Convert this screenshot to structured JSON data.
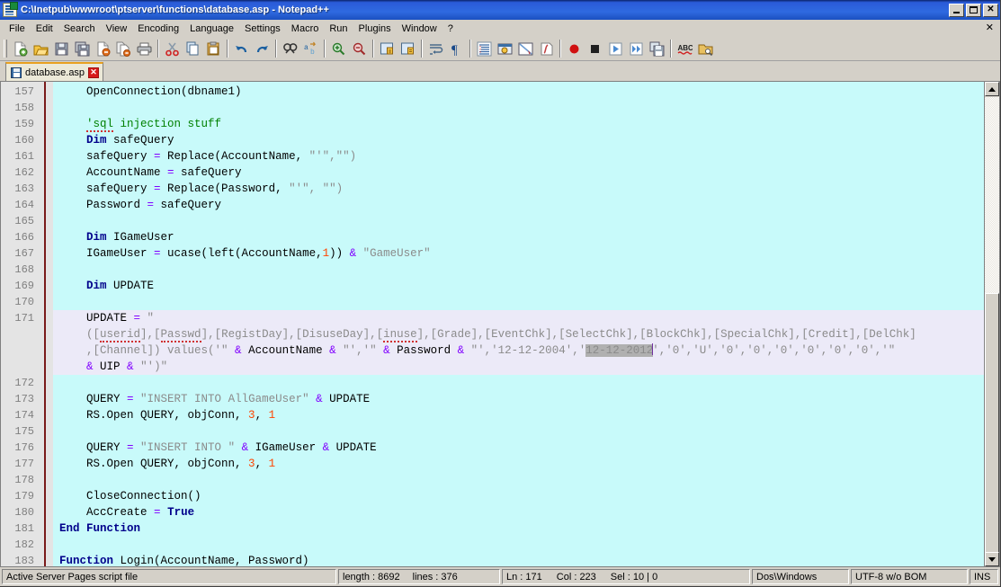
{
  "window": {
    "title": "C:\\Inetpub\\wwwroot\\ptserver\\functions\\database.asp - Notepad++",
    "icon": "notepad-plus-plus-icon",
    "minimize_label": "",
    "maximize_label": "",
    "close_label": "✕",
    "doc_close_label": "✕"
  },
  "menu": {
    "items": [
      {
        "label": "File"
      },
      {
        "label": "Edit"
      },
      {
        "label": "Search"
      },
      {
        "label": "View"
      },
      {
        "label": "Encoding"
      },
      {
        "label": "Language"
      },
      {
        "label": "Settings"
      },
      {
        "label": "Macro"
      },
      {
        "label": "Run"
      },
      {
        "label": "Plugins"
      },
      {
        "label": "Window"
      },
      {
        "label": "?"
      }
    ]
  },
  "toolbar": {
    "buttons": [
      {
        "name": "new-file-icon",
        "tooltip": "New"
      },
      {
        "name": "open-file-icon",
        "tooltip": "Open"
      },
      {
        "name": "save-icon",
        "tooltip": "Save"
      },
      {
        "name": "save-all-icon",
        "tooltip": "Save All"
      },
      {
        "name": "close-file-icon",
        "tooltip": "Close"
      },
      {
        "name": "close-all-icon",
        "tooltip": "Close All"
      },
      {
        "name": "print-icon",
        "tooltip": "Print"
      },
      {
        "name": "cut-icon",
        "tooltip": "Cut"
      },
      {
        "name": "copy-icon",
        "tooltip": "Copy"
      },
      {
        "name": "paste-icon",
        "tooltip": "Paste"
      },
      {
        "name": "undo-icon",
        "tooltip": "Undo"
      },
      {
        "name": "redo-icon",
        "tooltip": "Redo"
      },
      {
        "name": "find-icon",
        "tooltip": "Find"
      },
      {
        "name": "replace-icon",
        "tooltip": "Replace"
      },
      {
        "name": "zoom-in-icon",
        "tooltip": "Zoom In"
      },
      {
        "name": "zoom-out-icon",
        "tooltip": "Zoom Out"
      },
      {
        "name": "sync-vertical-icon",
        "tooltip": "Synchronize Vertical Scrolling"
      },
      {
        "name": "sync-horizontal-icon",
        "tooltip": "Synchronize Horizontal Scrolling"
      },
      {
        "name": "word-wrap-icon",
        "tooltip": "Word wrap"
      },
      {
        "name": "show-all-chars-icon",
        "tooltip": "Show All Characters"
      },
      {
        "name": "indent-guide-icon",
        "tooltip": "Show Indent Guide"
      },
      {
        "name": "user-defined-dlg-icon",
        "tooltip": "User-Defined Dialogue"
      },
      {
        "name": "doc-map-icon",
        "tooltip": "Document Map"
      },
      {
        "name": "function-list-icon",
        "tooltip": "Function List"
      },
      {
        "name": "record-macro-icon",
        "tooltip": "Start Recording"
      },
      {
        "name": "stop-macro-icon",
        "tooltip": "Stop Recording"
      },
      {
        "name": "play-macro-icon",
        "tooltip": "Playback"
      },
      {
        "name": "run-macro-multi-icon",
        "tooltip": "Run a Macro Multiple Times"
      },
      {
        "name": "save-macro-icon",
        "tooltip": "Save Current Recorded Macro"
      },
      {
        "name": "spell-check-icon",
        "tooltip": "Spell Check"
      },
      {
        "name": "run-icon",
        "tooltip": "Run"
      }
    ]
  },
  "tabs": [
    {
      "label": "database.asp",
      "icon": "saved-file-icon",
      "close_label": "✕",
      "active": true
    }
  ],
  "editor": {
    "first_line": 157,
    "lines": [
      {
        "num": "157",
        "highlight": false,
        "tokens": [
          {
            "t": "    OpenConnection(dbname1)",
            "c": "plain"
          }
        ]
      },
      {
        "num": "158",
        "highlight": false,
        "tokens": []
      },
      {
        "num": "159",
        "highlight": false,
        "tokens": [
          {
            "t": "    ",
            "c": "plain"
          },
          {
            "t": "'sql",
            "c": "cmt",
            "squiggly": true
          },
          {
            "t": " injection stuff",
            "c": "cmt"
          }
        ]
      },
      {
        "num": "160",
        "highlight": false,
        "tokens": [
          {
            "t": "    ",
            "c": "plain"
          },
          {
            "t": "Dim",
            "c": "kw"
          },
          {
            "t": " safeQuery",
            "c": "plain"
          }
        ]
      },
      {
        "num": "161",
        "highlight": false,
        "tokens": [
          {
            "t": "    safeQuery ",
            "c": "plain"
          },
          {
            "t": "=",
            "c": "op"
          },
          {
            "t": " Replace(AccountName, ",
            "c": "plain"
          },
          {
            "t": "\"'\",\"\")",
            "c": "str"
          }
        ]
      },
      {
        "num": "162",
        "highlight": false,
        "tokens": [
          {
            "t": "    AccountName ",
            "c": "plain"
          },
          {
            "t": "=",
            "c": "op"
          },
          {
            "t": " safeQuery",
            "c": "plain"
          }
        ]
      },
      {
        "num": "163",
        "highlight": false,
        "tokens": [
          {
            "t": "    safeQuery ",
            "c": "plain"
          },
          {
            "t": "=",
            "c": "op"
          },
          {
            "t": " Replace(Password, ",
            "c": "plain"
          },
          {
            "t": "\"'\", \"\")",
            "c": "str"
          }
        ]
      },
      {
        "num": "164",
        "highlight": false,
        "tokens": [
          {
            "t": "    Password ",
            "c": "plain"
          },
          {
            "t": "=",
            "c": "op"
          },
          {
            "t": " safeQuery",
            "c": "plain"
          }
        ]
      },
      {
        "num": "165",
        "highlight": false,
        "tokens": []
      },
      {
        "num": "166",
        "highlight": false,
        "tokens": [
          {
            "t": "    ",
            "c": "plain"
          },
          {
            "t": "Dim",
            "c": "kw"
          },
          {
            "t": " IGameUser",
            "c": "plain"
          }
        ]
      },
      {
        "num": "167",
        "highlight": false,
        "tokens": [
          {
            "t": "    IGameUser ",
            "c": "plain"
          },
          {
            "t": "=",
            "c": "op"
          },
          {
            "t": " ucase(left(AccountName,",
            "c": "plain"
          },
          {
            "t": "1",
            "c": "num"
          },
          {
            "t": ")) ",
            "c": "plain"
          },
          {
            "t": "&",
            "c": "op"
          },
          {
            "t": " ",
            "c": "plain"
          },
          {
            "t": "\"GameUser\"",
            "c": "str"
          }
        ]
      },
      {
        "num": "168",
        "highlight": false,
        "tokens": []
      },
      {
        "num": "169",
        "highlight": false,
        "tokens": [
          {
            "t": "    ",
            "c": "plain"
          },
          {
            "t": "Dim",
            "c": "kw"
          },
          {
            "t": " UPDATE",
            "c": "plain"
          }
        ]
      },
      {
        "num": "170",
        "highlight": false,
        "tokens": []
      },
      {
        "num": "171",
        "highlight": true,
        "tokens": [
          {
            "t": "    UPDATE ",
            "c": "plain"
          },
          {
            "t": "=",
            "c": "op"
          },
          {
            "t": " \"",
            "c": "str"
          }
        ]
      },
      {
        "num": "",
        "highlight": true,
        "tokens": [
          {
            "t": "    ([",
            "c": "str"
          },
          {
            "t": "userid",
            "c": "str",
            "squiggly": true
          },
          {
            "t": "],[",
            "c": "str"
          },
          {
            "t": "Passwd",
            "c": "str",
            "squiggly": true
          },
          {
            "t": "],[RegistDay],[DisuseDay],[",
            "c": "str"
          },
          {
            "t": "inuse",
            "c": "str",
            "squiggly": true
          },
          {
            "t": "],[Grade],[EventChk],[SelectChk],[BlockChk],[SpecialChk],[Credit],[DelChk]",
            "c": "str"
          }
        ]
      },
      {
        "num": "",
        "highlight": true,
        "tokens": [
          {
            "t": "    ,[Channel]) values('\" ",
            "c": "str"
          },
          {
            "t": "&",
            "c": "op"
          },
          {
            "t": " AccountName ",
            "c": "plain"
          },
          {
            "t": "&",
            "c": "op"
          },
          {
            "t": " \"','\" ",
            "c": "str"
          },
          {
            "t": "&",
            "c": "op"
          },
          {
            "t": " Password ",
            "c": "plain"
          },
          {
            "t": "&",
            "c": "op"
          },
          {
            "t": " \"','12-12-2004','",
            "c": "str"
          },
          {
            "t": "12-12-2012",
            "c": "str",
            "selected": true
          },
          {
            "t": "",
            "c": "caret"
          },
          {
            "t": "','0','U','0','0','0','0','0','0','\"",
            "c": "str"
          }
        ]
      },
      {
        "num": "",
        "highlight": true,
        "tokens": [
          {
            "t": "    ",
            "c": "str"
          },
          {
            "t": "&",
            "c": "op"
          },
          {
            "t": " UIP ",
            "c": "plain"
          },
          {
            "t": "&",
            "c": "op"
          },
          {
            "t": " \"')\"",
            "c": "str"
          }
        ]
      },
      {
        "num": "172",
        "highlight": false,
        "tokens": []
      },
      {
        "num": "173",
        "highlight": false,
        "tokens": [
          {
            "t": "    QUERY ",
            "c": "plain"
          },
          {
            "t": "=",
            "c": "op"
          },
          {
            "t": " ",
            "c": "plain"
          },
          {
            "t": "\"INSERT INTO AllGameUser\"",
            "c": "str"
          },
          {
            "t": " ",
            "c": "plain"
          },
          {
            "t": "&",
            "c": "op"
          },
          {
            "t": " UPDATE",
            "c": "plain"
          }
        ]
      },
      {
        "num": "174",
        "highlight": false,
        "tokens": [
          {
            "t": "    RS.Open QUERY, objConn, ",
            "c": "plain"
          },
          {
            "t": "3",
            "c": "num"
          },
          {
            "t": ", ",
            "c": "plain"
          },
          {
            "t": "1",
            "c": "num"
          }
        ]
      },
      {
        "num": "175",
        "highlight": false,
        "tokens": []
      },
      {
        "num": "176",
        "highlight": false,
        "tokens": [
          {
            "t": "    QUERY ",
            "c": "plain"
          },
          {
            "t": "=",
            "c": "op"
          },
          {
            "t": " ",
            "c": "plain"
          },
          {
            "t": "\"INSERT INTO \"",
            "c": "str"
          },
          {
            "t": " ",
            "c": "plain"
          },
          {
            "t": "&",
            "c": "op"
          },
          {
            "t": " IGameUser ",
            "c": "plain"
          },
          {
            "t": "&",
            "c": "op"
          },
          {
            "t": " UPDATE",
            "c": "plain"
          }
        ]
      },
      {
        "num": "177",
        "highlight": false,
        "tokens": [
          {
            "t": "    RS.Open QUERY, objConn, ",
            "c": "plain"
          },
          {
            "t": "3",
            "c": "num"
          },
          {
            "t": ", ",
            "c": "plain"
          },
          {
            "t": "1",
            "c": "num"
          }
        ]
      },
      {
        "num": "178",
        "highlight": false,
        "tokens": []
      },
      {
        "num": "179",
        "highlight": false,
        "tokens": [
          {
            "t": "    CloseConnection()",
            "c": "plain"
          }
        ]
      },
      {
        "num": "180",
        "highlight": false,
        "tokens": [
          {
            "t": "    AccCreate ",
            "c": "plain"
          },
          {
            "t": "=",
            "c": "op"
          },
          {
            "t": " ",
            "c": "plain"
          },
          {
            "t": "True",
            "c": "kw"
          }
        ]
      },
      {
        "num": "181",
        "highlight": false,
        "tokens": [
          {
            "t": "End Function",
            "c": "kw"
          }
        ]
      },
      {
        "num": "182",
        "highlight": false,
        "tokens": []
      },
      {
        "num": "183",
        "highlight": false,
        "tokens": [
          {
            "t": "Function",
            "c": "kw"
          },
          {
            "t": " Login(AccountName, Password)",
            "c": "plain"
          }
        ]
      }
    ]
  },
  "statusbar": {
    "doc_type": "Active Server Pages script file",
    "length_label": "length : 8692",
    "lines_label": "lines : 376",
    "ln": "Ln : 171",
    "col": "Col : 223",
    "sel": "Sel : 10 | 0",
    "eol": "Dos\\Windows",
    "encoding": "UTF-8 w/o BOM",
    "insert_mode": "INS"
  },
  "colors": {
    "titlebar_accent": "#2a5ad8",
    "editor_bg": "#c8fafa",
    "current_line_bg": "#eceaf8",
    "keyword": "#00008b",
    "comment": "#008000",
    "string": "#8b8b8b",
    "operator": "#8000ff",
    "number": "#ff4500",
    "selection": "#b0b0b0",
    "gutter_bg": "#e4e4e4",
    "fold_line": "#7a1a1a"
  }
}
